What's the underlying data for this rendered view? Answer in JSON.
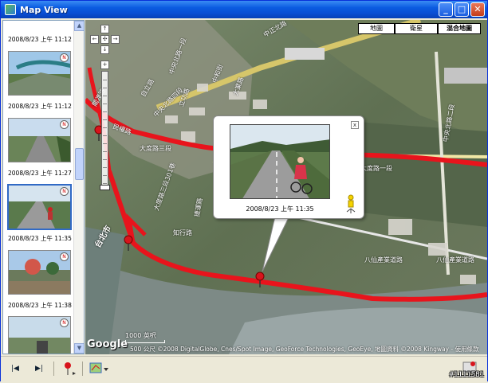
{
  "window": {
    "title": "Map View"
  },
  "thumbnails": [
    {
      "caption": "2008/8/23 上午 11:12"
    },
    {
      "caption": "2008/8/23 上午 11:12"
    },
    {
      "caption": "2008/8/23 上午 11:27"
    },
    {
      "caption": "2008/8/23 上午 11:35"
    },
    {
      "caption": "2008/8/23 上午 11:38"
    }
  ],
  "map_type": {
    "map": "地圖",
    "satellite": "衛星",
    "hybrid": "混合地圖",
    "selected": "混合地圖"
  },
  "map_labels": {
    "road1": "中正北路",
    "road2": "大度路三段",
    "road3": "大度路一段",
    "road4": "八仙產業道路",
    "road5": "八仙產業道路",
    "road6": "知行路",
    "road7": "民權路",
    "road8": "關渡路",
    "road9": "自立路",
    "road10": "大度路三段301巷",
    "road11": "中央北路一段",
    "road12": "中央北路四段",
    "road13": "立功路",
    "road14": "中央北路二段",
    "road15": "台北市",
    "road16": "捷運路",
    "road17": "中和街",
    "road18": "大業路"
  },
  "popup": {
    "caption": "2008/8/23 上午 11:35",
    "close": "x"
  },
  "scale": {
    "label": "1000 英呎",
    "label2": "500 公尺"
  },
  "google": "Google",
  "copyright": "©2008 DigitalGlobe, Cnes/Spot Image, GeoForce Technologies, GeoEye, 地圖資料 ©2008 Kingway - 使用條款",
  "watermark": "#1111581",
  "colors": {
    "route": "#E8141C",
    "titlebar": "#0A5BE0",
    "selection": "#316AC5"
  }
}
